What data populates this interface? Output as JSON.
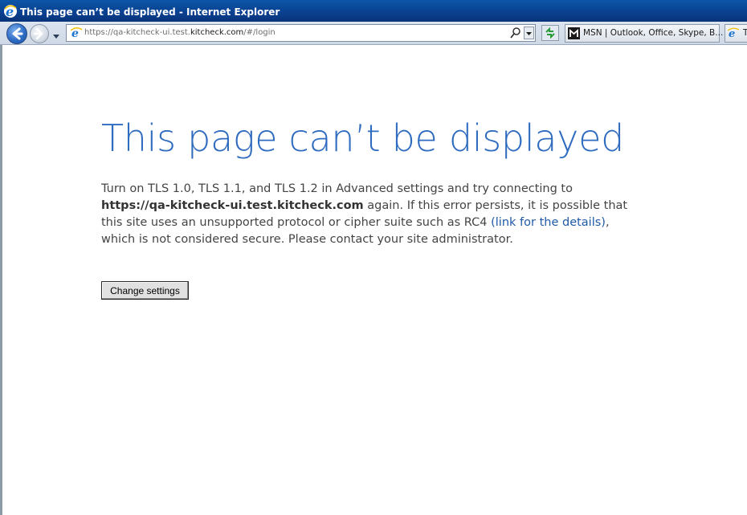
{
  "window": {
    "title": "This page can’t be displayed - Internet Explorer"
  },
  "toolbar": {
    "url_prefix": "https://qa-kitcheck-ui.test.",
    "url_domain": "kitcheck.com",
    "url_suffix": "/#/login",
    "tabs": [
      {
        "label": "MSN | Outlook, Office, Skype, B...",
        "icon": "msn-icon"
      },
      {
        "label": "T",
        "icon": "ie-page-icon"
      }
    ]
  },
  "page": {
    "title": "This page can’t be displayed",
    "body_part1": "Turn on TLS 1.0, TLS 1.1, and TLS 1.2 in Advanced settings and try connecting to ",
    "body_host": "https://qa-kitcheck-ui.test.kitcheck.com",
    "body_part2": " again. If this error persists, it is possible that this site uses an unsupported protocol or cipher suite such as RC4 ",
    "body_link": "(link for the details)",
    "body_part3": ", which is not considered secure. Please contact your site administrator.",
    "change_settings_label": "Change settings"
  },
  "colors": {
    "title_bar": "#0a3f8f",
    "error_title": "#2f6bbf",
    "link": "#1f5aa8"
  }
}
